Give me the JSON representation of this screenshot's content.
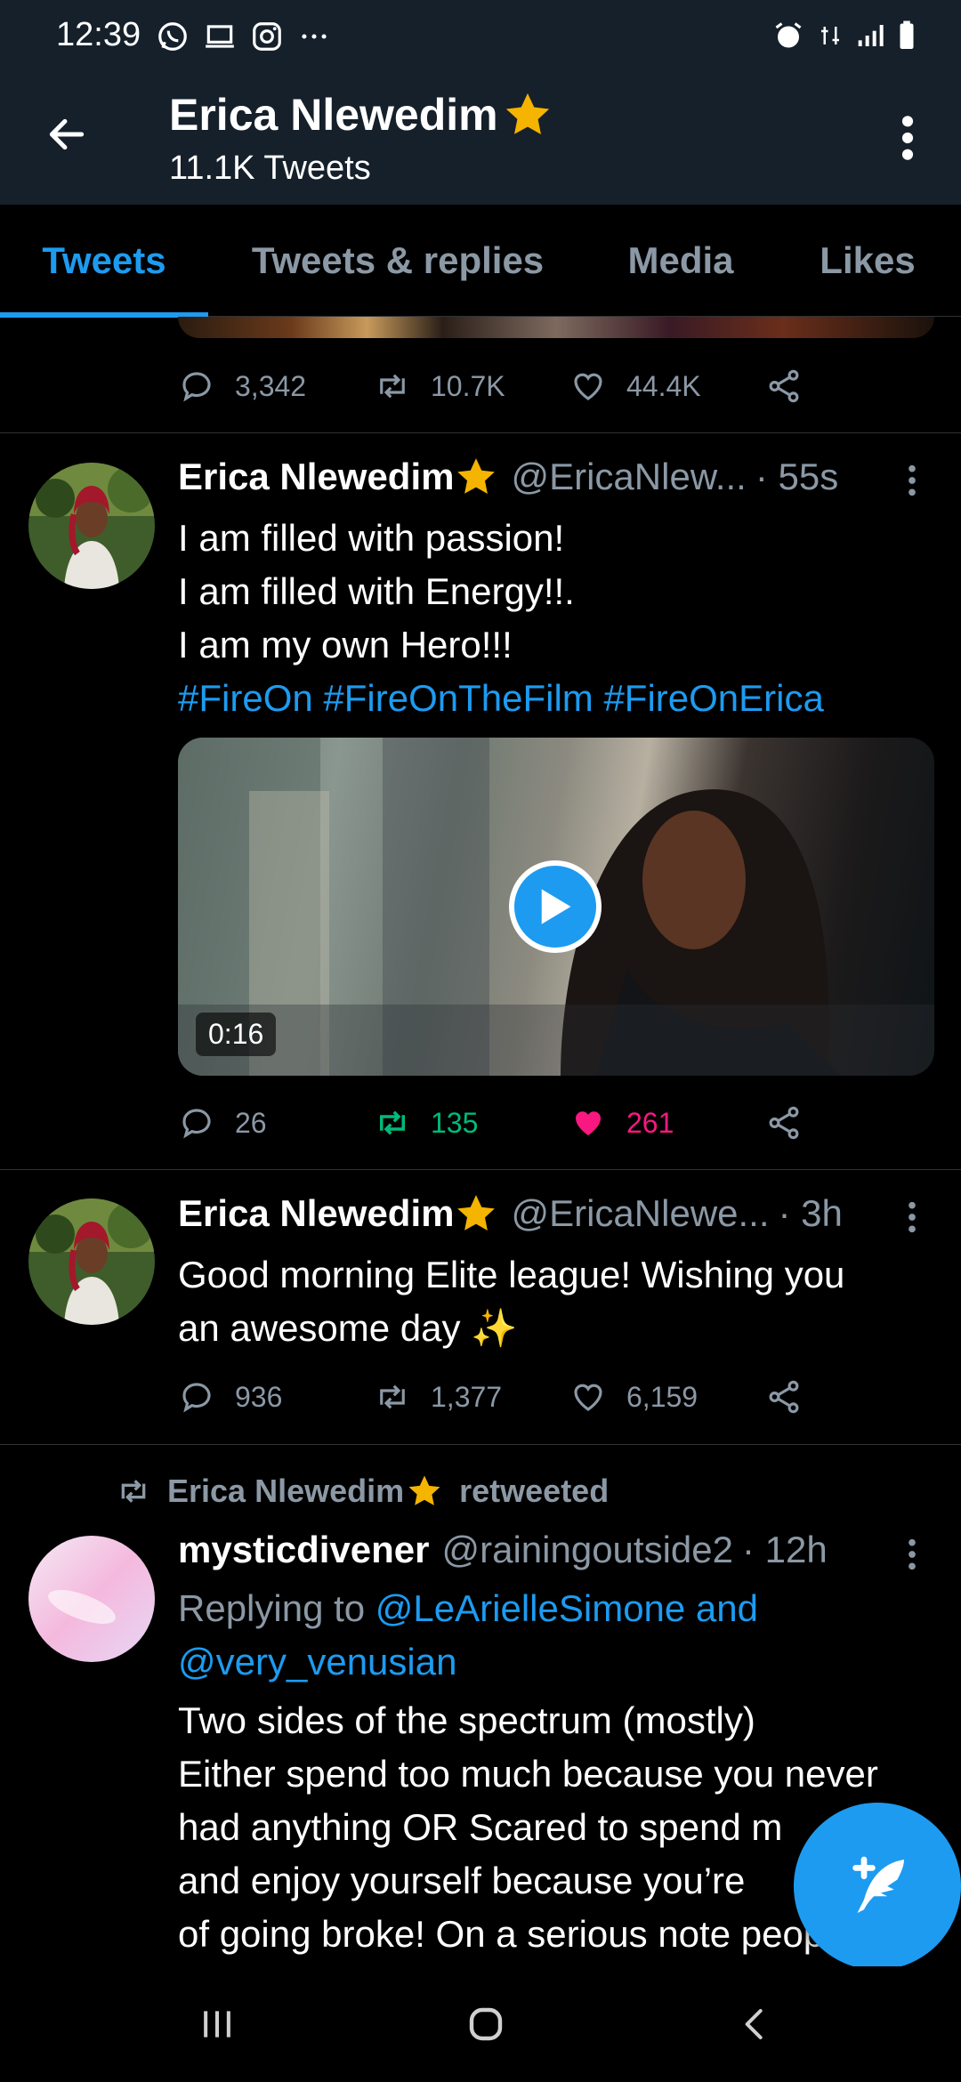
{
  "status_bar": {
    "time": "12:39",
    "left_icons": [
      "whatsapp-icon",
      "laptop-icon",
      "instagram-icon",
      "more-dots-icon"
    ],
    "right_icons": [
      "alarm-icon",
      "data-icon",
      "signal-icon",
      "battery-icon"
    ]
  },
  "header": {
    "name": "Erica Nlewedim",
    "tweet_count": "11.1K Tweets",
    "verified_emoji": "★"
  },
  "tabs": [
    {
      "label": "Tweets",
      "active": true
    },
    {
      "label": "Tweets & replies",
      "active": false
    },
    {
      "label": "Media",
      "active": false
    },
    {
      "label": "Likes",
      "active": false
    }
  ],
  "prev_tweet": {
    "replies": "3,342",
    "retweets": "10.7K",
    "likes": "44.4K"
  },
  "tweets": [
    {
      "name": "Erica Nlewedim",
      "handle": "@EricaNlew...",
      "time": "· 55s",
      "lines": [
        "I am filled with passion!",
        "I am filled with Energy!!.",
        "I am my own Hero!!!"
      ],
      "hashtags": "#FireOn #FireOnTheFilm #FireOnErica",
      "video_duration": "0:16",
      "replies": "26",
      "retweets": "135",
      "likes": "261",
      "retweeted": true,
      "liked": true
    },
    {
      "name": "Erica Nlewedim",
      "handle": "@EricaNlewe...",
      "time": "· 3h",
      "lines": [
        "Good morning Elite league! Wishing you",
        "an awesome day ✨"
      ],
      "replies": "936",
      "retweets": "1,377",
      "likes": "6,159"
    },
    {
      "retweeted_by": "Erica Nlewedim",
      "retweeted_suffix": "retweeted",
      "name": "mysticdivener",
      "handle": "@rainingoutside2",
      "time": "· 12h",
      "reply_prefix": "Replying to ",
      "reply_mention_1": "@LeArielleSimone and",
      "reply_mention_2": "@very_venusian",
      "lines": [
        "Two sides of the spectrum (mostly)",
        "Either spend too much because you never",
        "had anything OR Scared to spend m",
        "and enjoy yourself because you’re",
        "of going broke! On a serious note people"
      ]
    }
  ],
  "colors": {
    "header_bg": "#15202b",
    "accent": "#1d9bf0",
    "retweet_green": "#00ba7c",
    "like_pink": "#f91880",
    "muted": "#8b98a5",
    "star": "#f4b400"
  }
}
